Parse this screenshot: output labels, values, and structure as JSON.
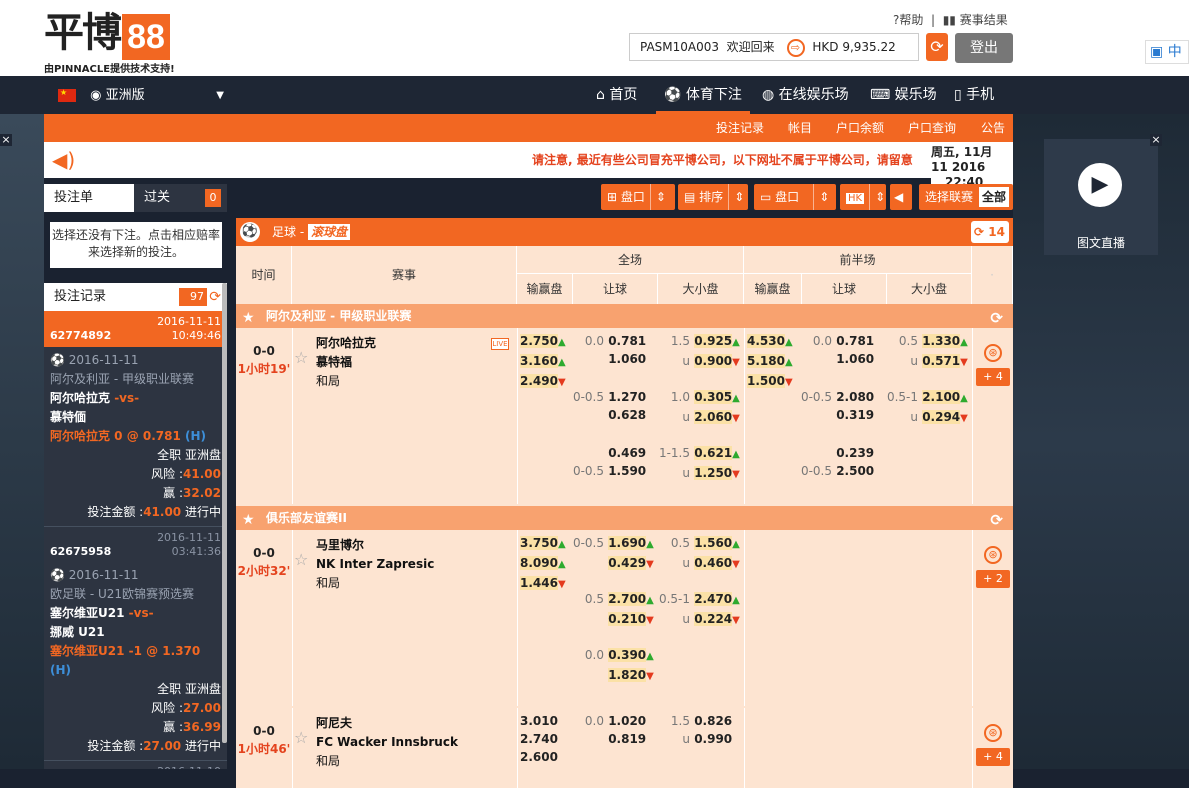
{
  "header": {
    "logo_main": "平博",
    "logo_num": "88",
    "logo_tagline": "由PINNACLE提供技术支持!",
    "help": "帮助",
    "results": "赛事结果",
    "account_id": "PASM10A003",
    "welcome": "欢迎回来",
    "currency": "HKD",
    "balance": "9,935.22",
    "logout": "登出",
    "bing": "中"
  },
  "nav": {
    "region": "亚洲版",
    "items": [
      "首页",
      "体育下注",
      "在线娱乐场",
      "娱乐场",
      "手机"
    ],
    "active": "体育下注"
  },
  "subnav": [
    "投注记录",
    "帐目",
    "户口余额",
    "户口查询",
    "公告"
  ],
  "notice": {
    "message": "请注意, 最近有些公司冒充平博公司，以下网址不属于平博公司，请留意",
    "date_line1": "周五, 11月 11 2016",
    "date_line2": "22:40"
  },
  "betslip": {
    "tab_single": "投注单",
    "tab_parlay": "过关",
    "parlay_count": "0",
    "hint": "选择还没有下注。点击相应赔率来选择新的投注。",
    "records_label": "投注记录",
    "records_count": "97"
  },
  "records": [
    {
      "id": "62774892",
      "date": "2016-11-11",
      "time": "10:49:46",
      "highlight": true,
      "match_date": "2016-11-11",
      "league": "阿尔及利亚 - 甲级职业联赛",
      "home": "阿尔哈拉克",
      "vs": "-vs-",
      "away": "慕特偭",
      "selection": "阿尔哈拉克 0 @ 0.781",
      "side": "(H)",
      "market": "全职 亚洲盘",
      "risk_label": "风险 :",
      "risk": "41.00",
      "win_label": "赢 :",
      "win": "32.02",
      "stake_label": "投注金额 :",
      "stake": "41.00",
      "status": "进行中"
    },
    {
      "id": "62675958",
      "date": "2016-11-11",
      "time": "03:41:36",
      "highlight": false,
      "match_date": "2016-11-11",
      "league": "欧足联 - U21欧锦赛预选赛",
      "home": "塞尔维亚U21",
      "vs": "-vs-",
      "away": "挪威 U21",
      "selection": "塞尔维亚U21 -1 @ 1.370",
      "side": "(H)",
      "market": "全职 亚洲盘",
      "risk_label": "风险 :",
      "risk": "27.00",
      "win_label": "赢 :",
      "win": "36.99",
      "stake_label": "投注金额 :",
      "stake": "27.00",
      "status": "进行中"
    }
  ],
  "records_next_date": "2016-11-10",
  "controls": {
    "market": "盘口",
    "sort": "排序",
    "view": "盘口",
    "odds_format": "HK",
    "select_league": "选择联赛",
    "all": "全部"
  },
  "sport": {
    "name": "足球",
    "mode": "滚球盘",
    "count": "14"
  },
  "columns": {
    "time": "时间",
    "event": "赛事",
    "fulltime": "全场",
    "firsthalf": "前半场",
    "moneyline": "输赢盘",
    "handicap": "让球",
    "overunder": "大小盘"
  },
  "leagues": [
    {
      "name": "阿尔及利亚 - 甲级职业联赛",
      "matches": [
        {
          "score": "0-0",
          "time": "1小时19'",
          "home": "阿尔哈拉克",
          "away": "慕特福",
          "draw": "和局",
          "live_badge": "LIVE",
          "ft_ml": [
            "2.750",
            "3.160",
            "2.490"
          ],
          "ft_hdp": [
            [
              "0.0",
              "0.781",
              "",
              "1.060"
            ],
            [
              "0-0.5",
              "1.270",
              "",
              "0.628"
            ],
            [
              "",
              "0.469",
              "0-0.5",
              "1.590"
            ]
          ],
          "ft_ou": [
            [
              "1.5",
              "0.925",
              "u",
              "0.900"
            ],
            [
              "1.0",
              "0.305",
              "u",
              "2.060"
            ],
            [
              "1-1.5",
              "0.621",
              "u",
              "1.250"
            ]
          ],
          "fh_ml": [
            "4.530",
            "5.180",
            "1.500"
          ],
          "fh_hdp": [
            [
              "0.0",
              "0.781",
              "",
              "1.060"
            ],
            [
              "0-0.5",
              "2.080",
              "",
              "0.319"
            ],
            [
              "",
              "0.239",
              "0-0.5",
              "2.500"
            ]
          ],
          "fh_ou": [
            [
              "0.5",
              "1.330",
              "u",
              "0.571"
            ],
            [
              "0.5-1",
              "2.100",
              "u",
              "0.294"
            ]
          ],
          "more": "+ 4"
        }
      ]
    },
    {
      "name": "俱乐部友谊赛II",
      "matches": [
        {
          "score": "0-0",
          "time": "2小时32'",
          "home": "马里博尔",
          "away": "NK Inter Zapresic",
          "draw": "和局",
          "ft_ml": [
            "3.750",
            "8.090",
            "1.446"
          ],
          "ft_hdp": [
            [
              "0-0.5",
              "1.690",
              "",
              "0.429"
            ],
            [
              "0.5",
              "2.700",
              "",
              "0.210"
            ],
            [
              "0.0",
              "0.390",
              "",
              "1.820"
            ]
          ],
          "ft_ou": [
            [
              "0.5",
              "1.560",
              "u",
              "0.460"
            ],
            [
              "0.5-1",
              "2.470",
              "u",
              "0.224"
            ]
          ],
          "more": "+ 2"
        },
        {
          "score": "0-0",
          "time": "1小时46'",
          "home": "阿尼夫",
          "away": "FC Wacker Innsbruck",
          "draw": "和局",
          "ft_ml": [
            "3.010",
            "2.740",
            "2.600"
          ],
          "ft_hdp": [
            [
              "0.0",
              "1.020",
              "",
              "0.819"
            ]
          ],
          "ft_ou": [
            [
              "1.5",
              "0.826",
              "u",
              "0.990"
            ]
          ],
          "more": "+ 4"
        }
      ]
    }
  ],
  "promo": {
    "label": "图文直播"
  },
  "colors": {
    "accent": "#f26722",
    "dark": "#1e2634",
    "grid_bg": "#fde4d1",
    "odds_highlight": "#fbe1a6"
  }
}
